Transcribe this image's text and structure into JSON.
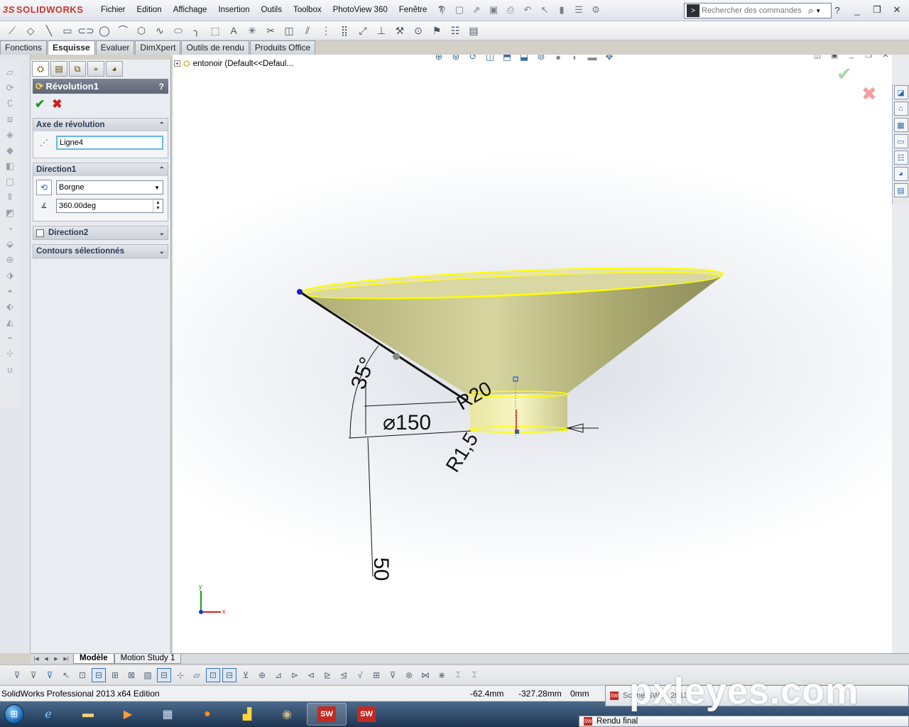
{
  "app": {
    "brand": "SOLIDWORKS",
    "menus": [
      "Fichier",
      "Edition",
      "Affichage",
      "Insertion",
      "Outils",
      "Toolbox",
      "PhotoView 360",
      "Fenêtre",
      "?"
    ],
    "search_placeholder": "Rechercher des commandes"
  },
  "tabs": [
    {
      "label": "Fonctions",
      "active": false
    },
    {
      "label": "Esquisse",
      "active": true
    },
    {
      "label": "Evaluer",
      "active": false
    },
    {
      "label": "DimXpert",
      "active": false
    },
    {
      "label": "Outils de rendu",
      "active": false
    },
    {
      "label": "Produits Office",
      "active": false
    }
  ],
  "property_manager": {
    "title": "Révolution1",
    "help": "?",
    "axis_group": {
      "title": "Axe de révolution",
      "value": "Ligne4"
    },
    "direction1": {
      "title": "Direction1",
      "type": "Borgne",
      "angle": "360.00deg"
    },
    "direction2": {
      "title": "Direction2"
    },
    "contours": {
      "title": "Contours sélectionnés"
    }
  },
  "feature_tree": {
    "root": "entonoir  (Default<<Defaul..."
  },
  "sketch": {
    "dim_angle": "35°",
    "dim_diameter": "⌀150",
    "dim_r20": "R20",
    "dim_r15": "R1,5",
    "dim_50": "50"
  },
  "axes": {
    "x": "x",
    "y": "y"
  },
  "bottom_tabs": [
    {
      "label": "Modèle",
      "active": true
    },
    {
      "label": "Motion Study 1",
      "active": false
    }
  ],
  "status": {
    "text": "SolidWorks Professional 2013 x64 Edition",
    "x": "-62.4mm",
    "y": "-327.28mm",
    "z": "0mm"
  },
  "taskbar_popups": {
    "top": "Scène SW ... 2013",
    "bottom": "Rendu final"
  },
  "watermark": "pxleyes.com",
  "colors": {
    "accent": "#c8372d",
    "highlight": "#ffff00",
    "cone": "#c9c78f"
  }
}
